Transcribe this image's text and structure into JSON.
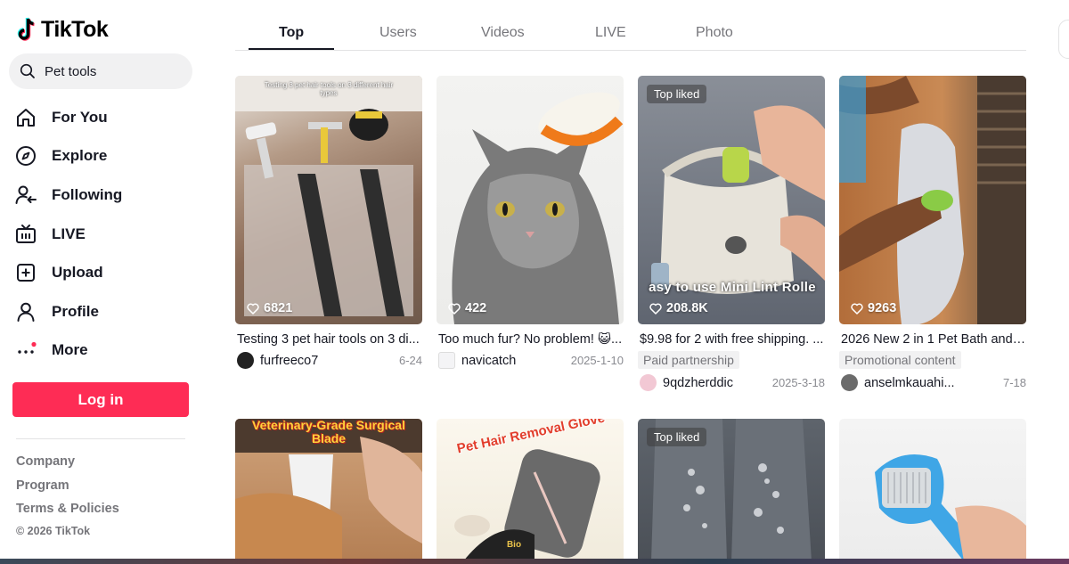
{
  "app": {
    "logo_text": "TikTok"
  },
  "search": {
    "value": "Pet tools"
  },
  "nav": [
    {
      "label": "For You",
      "icon": "home-icon"
    },
    {
      "label": "Explore",
      "icon": "compass-icon"
    },
    {
      "label": "Following",
      "icon": "following-icon"
    },
    {
      "label": "LIVE",
      "icon": "live-icon"
    },
    {
      "label": "Upload",
      "icon": "upload-icon"
    },
    {
      "label": "Profile",
      "icon": "profile-icon"
    },
    {
      "label": "More",
      "icon": "more-icon"
    }
  ],
  "login": {
    "label": "Log in"
  },
  "footer": {
    "company": "Company",
    "program": "Program",
    "terms": "Terms & Policies",
    "copyright": "© 2026 TikTok"
  },
  "tabs": [
    {
      "label": "Top",
      "active": true
    },
    {
      "label": "Users",
      "active": false
    },
    {
      "label": "Videos",
      "active": false
    },
    {
      "label": "LIVE",
      "active": false
    },
    {
      "label": "Photo",
      "active": false
    }
  ],
  "colors": {
    "accent": "#fe2c55",
    "text": "#161823",
    "muted": "#75757a"
  },
  "videos": [
    {
      "likes": "6821",
      "overlay": "Testing 3 pet hair tools on 3 different hair types",
      "description": "Testing 3 pet hair tools on 3 di...",
      "author": "furfreeco7",
      "date": "6-24"
    },
    {
      "likes": "422",
      "description": "Too much fur? No problem! 😺...",
      "author": "navicatch",
      "date": "2025-1-10"
    },
    {
      "likes": "208.8K",
      "badge": "Top liked",
      "overlay": "asy to use Mini Lint Rolle",
      "description": "$9.98 for 2 with free shipping. ...",
      "tag": "Paid partnership",
      "author": "9qdzherddic",
      "date": "2025-3-18"
    },
    {
      "likes": "9263",
      "description": "2026 New 2 in 1 Pet Bath and ...",
      "tag": "Promotional content",
      "author": "anselmkauahi...",
      "date": "7-18"
    },
    {
      "overlay": "Veterinary-Grade Surgical Blade"
    },
    {
      "overlay": "Pet Hair Removal Glove",
      "overlay2": "Bio"
    },
    {
      "badge": "Top liked"
    },
    {}
  ]
}
